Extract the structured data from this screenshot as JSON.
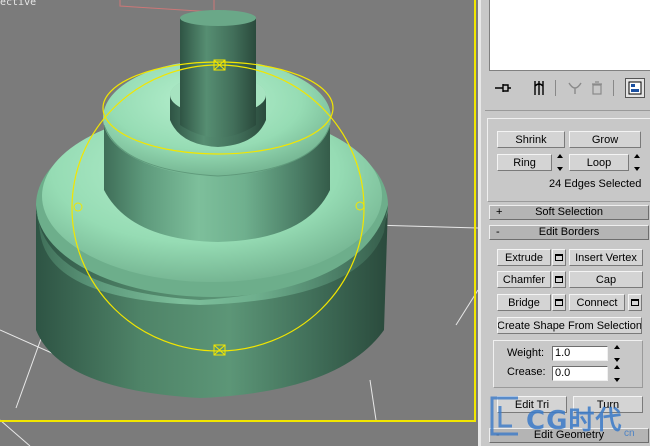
{
  "viewport": {
    "label": "ective"
  },
  "toolbar": {
    "pin": "pin-stack-icon",
    "show_end": "show-end-result-icon",
    "make_unique": "make-unique-icon",
    "remove": "remove-modifier-icon",
    "configure": "configure-sets-icon"
  },
  "selection": {
    "shrink": "Shrink",
    "grow": "Grow",
    "ring": "Ring",
    "loop": "Loop",
    "status": "24 Edges Selected"
  },
  "rollouts": {
    "soft_selection": {
      "sign": "+",
      "title": "Soft Selection"
    },
    "edit_borders": {
      "sign": "-",
      "title": "Edit Borders"
    },
    "edit_geometry": {
      "sign": "-",
      "title": "Edit Geometry"
    }
  },
  "edit_borders": {
    "extrude": "Extrude",
    "insert_vertex": "Insert Vertex",
    "chamfer": "Chamfer",
    "cap": "Cap",
    "bridge": "Bridge",
    "connect": "Connect",
    "create_shape": "Create Shape From Selection",
    "weight_label": "Weight:",
    "weight_value": "1.0",
    "crease_label": "Crease:",
    "crease_value": "0.0",
    "edit_tri": "Edit Tri",
    "turn": "Turn"
  },
  "watermark": {
    "brand": "CG时代",
    "site": "cn"
  },
  "colors": {
    "selection": "#f2e600",
    "object": "#8fd4ac",
    "viewport_bg": "#7b7b7b"
  }
}
